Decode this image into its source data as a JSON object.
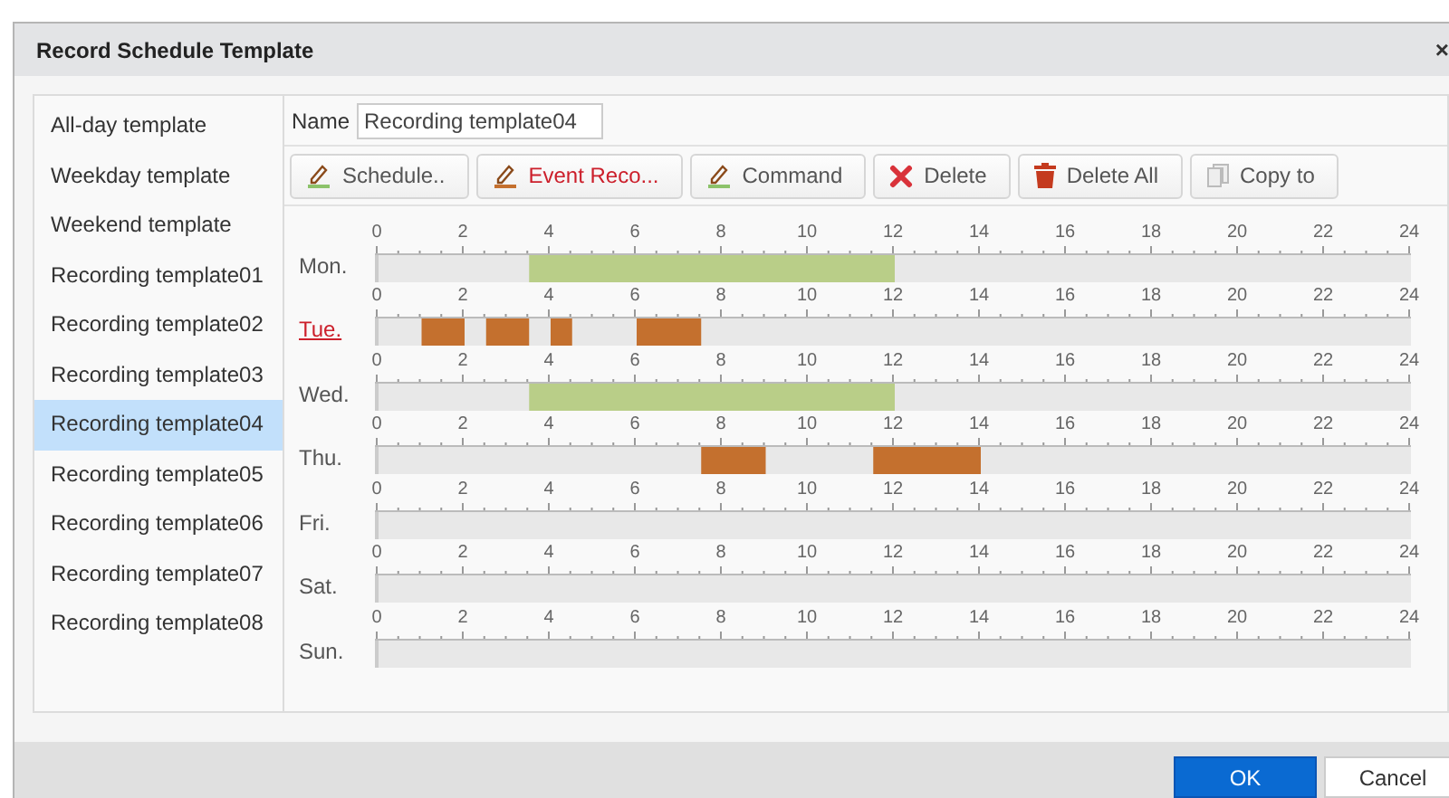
{
  "dialog": {
    "title": "Record Schedule Template",
    "close": "×"
  },
  "templates": [
    {
      "label": "All-day template",
      "selected": false
    },
    {
      "label": "Weekday template",
      "selected": false
    },
    {
      "label": "Weekend template",
      "selected": false
    },
    {
      "label": "Recording template01",
      "selected": false
    },
    {
      "label": "Recording template02",
      "selected": false
    },
    {
      "label": "Recording template03",
      "selected": false
    },
    {
      "label": "Recording template04",
      "selected": true
    },
    {
      "label": "Recording template05",
      "selected": false
    },
    {
      "label": "Recording template06",
      "selected": false
    },
    {
      "label": "Recording template07",
      "selected": false
    },
    {
      "label": "Recording template08",
      "selected": false
    }
  ],
  "name_field": {
    "label": "Name",
    "value": "Recording template04"
  },
  "toolbar": [
    {
      "kind": "schedule",
      "label": "Schedule..",
      "selected": false
    },
    {
      "kind": "event",
      "label": "Event Reco...",
      "selected": true
    },
    {
      "kind": "command",
      "label": "Command",
      "selected": false
    },
    {
      "kind": "delete",
      "label": "Delete",
      "selected": false
    },
    {
      "kind": "delete_all",
      "label": "Delete All",
      "selected": false
    },
    {
      "kind": "copy",
      "label": "Copy to",
      "selected": false
    }
  ],
  "days": [
    {
      "label": "Mon.",
      "selected": false,
      "ticks": [
        "0",
        "2",
        "4",
        "6",
        "8",
        "10",
        "12",
        "14",
        "16",
        "18",
        "20",
        "22",
        "24"
      ],
      "half_hours": [
        {
          "kind": "off"
        },
        {
          "kind": "off"
        },
        {
          "kind": "off"
        },
        {
          "kind": "off"
        },
        {
          "kind": "off"
        },
        {
          "kind": "off"
        },
        {
          "kind": "off"
        },
        {
          "kind": "schedule"
        },
        {
          "kind": "schedule"
        },
        {
          "kind": "schedule"
        },
        {
          "kind": "schedule"
        },
        {
          "kind": "schedule"
        },
        {
          "kind": "schedule"
        },
        {
          "kind": "schedule"
        },
        {
          "kind": "schedule"
        },
        {
          "kind": "schedule"
        },
        {
          "kind": "schedule"
        },
        {
          "kind": "schedule"
        },
        {
          "kind": "schedule"
        },
        {
          "kind": "schedule"
        },
        {
          "kind": "schedule"
        },
        {
          "kind": "schedule"
        },
        {
          "kind": "schedule"
        },
        {
          "kind": "schedule"
        },
        {
          "kind": "off"
        },
        {
          "kind": "off"
        },
        {
          "kind": "off"
        },
        {
          "kind": "off"
        },
        {
          "kind": "off"
        },
        {
          "kind": "off"
        },
        {
          "kind": "off"
        },
        {
          "kind": "off"
        },
        {
          "kind": "off"
        },
        {
          "kind": "off"
        },
        {
          "kind": "off"
        },
        {
          "kind": "off"
        },
        {
          "kind": "off"
        },
        {
          "kind": "off"
        },
        {
          "kind": "off"
        },
        {
          "kind": "off"
        },
        {
          "kind": "off"
        },
        {
          "kind": "off"
        },
        {
          "kind": "off"
        },
        {
          "kind": "off"
        },
        {
          "kind": "off"
        },
        {
          "kind": "off"
        },
        {
          "kind": "off"
        },
        {
          "kind": "off"
        }
      ]
    },
    {
      "label": "Tue.",
      "selected": true,
      "ticks": [
        "0",
        "2",
        "4",
        "6",
        "8",
        "10",
        "12",
        "14",
        "16",
        "18",
        "20",
        "22",
        "24"
      ],
      "half_hours": [
        {
          "kind": "off"
        },
        {
          "kind": "off"
        },
        {
          "kind": "event"
        },
        {
          "kind": "event"
        },
        {
          "kind": "off"
        },
        {
          "kind": "event"
        },
        {
          "kind": "event"
        },
        {
          "kind": "off"
        },
        {
          "kind": "event"
        },
        {
          "kind": "off"
        },
        {
          "kind": "off"
        },
        {
          "kind": "off"
        },
        {
          "kind": "event"
        },
        {
          "kind": "event"
        },
        {
          "kind": "event"
        },
        {
          "kind": "off"
        },
        {
          "kind": "off"
        },
        {
          "kind": "off"
        },
        {
          "kind": "off"
        },
        {
          "kind": "off"
        },
        {
          "kind": "off"
        },
        {
          "kind": "off"
        },
        {
          "kind": "off"
        },
        {
          "kind": "off"
        },
        {
          "kind": "off"
        },
        {
          "kind": "off"
        },
        {
          "kind": "off"
        },
        {
          "kind": "off"
        },
        {
          "kind": "off"
        },
        {
          "kind": "off"
        },
        {
          "kind": "off"
        },
        {
          "kind": "off"
        },
        {
          "kind": "off"
        },
        {
          "kind": "off"
        },
        {
          "kind": "off"
        },
        {
          "kind": "off"
        },
        {
          "kind": "off"
        },
        {
          "kind": "off"
        },
        {
          "kind": "off"
        },
        {
          "kind": "off"
        },
        {
          "kind": "off"
        },
        {
          "kind": "off"
        },
        {
          "kind": "off"
        },
        {
          "kind": "off"
        },
        {
          "kind": "off"
        },
        {
          "kind": "off"
        },
        {
          "kind": "off"
        },
        {
          "kind": "off"
        }
      ]
    },
    {
      "label": "Wed.",
      "selected": false,
      "ticks": [
        "0",
        "2",
        "4",
        "6",
        "8",
        "10",
        "12",
        "14",
        "16",
        "18",
        "20",
        "22",
        "24"
      ],
      "half_hours": [
        {
          "kind": "off"
        },
        {
          "kind": "off"
        },
        {
          "kind": "off"
        },
        {
          "kind": "off"
        },
        {
          "kind": "off"
        },
        {
          "kind": "off"
        },
        {
          "kind": "off"
        },
        {
          "kind": "schedule"
        },
        {
          "kind": "schedule"
        },
        {
          "kind": "schedule"
        },
        {
          "kind": "schedule"
        },
        {
          "kind": "schedule"
        },
        {
          "kind": "schedule"
        },
        {
          "kind": "schedule"
        },
        {
          "kind": "schedule"
        },
        {
          "kind": "schedule"
        },
        {
          "kind": "schedule"
        },
        {
          "kind": "schedule"
        },
        {
          "kind": "schedule"
        },
        {
          "kind": "schedule"
        },
        {
          "kind": "schedule"
        },
        {
          "kind": "schedule"
        },
        {
          "kind": "schedule"
        },
        {
          "kind": "schedule"
        },
        {
          "kind": "off"
        },
        {
          "kind": "off"
        },
        {
          "kind": "off"
        },
        {
          "kind": "off"
        },
        {
          "kind": "off"
        },
        {
          "kind": "off"
        },
        {
          "kind": "off"
        },
        {
          "kind": "off"
        },
        {
          "kind": "off"
        },
        {
          "kind": "off"
        },
        {
          "kind": "off"
        },
        {
          "kind": "off"
        },
        {
          "kind": "off"
        },
        {
          "kind": "off"
        },
        {
          "kind": "off"
        },
        {
          "kind": "off"
        },
        {
          "kind": "off"
        },
        {
          "kind": "off"
        },
        {
          "kind": "off"
        },
        {
          "kind": "off"
        },
        {
          "kind": "off"
        },
        {
          "kind": "off"
        },
        {
          "kind": "off"
        },
        {
          "kind": "off"
        }
      ]
    },
    {
      "label": "Thu.",
      "selected": false,
      "ticks": [
        "0",
        "2",
        "4",
        "6",
        "8",
        "10",
        "12",
        "14",
        "16",
        "18",
        "20",
        "22",
        "24"
      ],
      "half_hours": [
        {
          "kind": "off"
        },
        {
          "kind": "off"
        },
        {
          "kind": "off"
        },
        {
          "kind": "off"
        },
        {
          "kind": "off"
        },
        {
          "kind": "off"
        },
        {
          "kind": "off"
        },
        {
          "kind": "off"
        },
        {
          "kind": "off"
        },
        {
          "kind": "off"
        },
        {
          "kind": "off"
        },
        {
          "kind": "off"
        },
        {
          "kind": "off"
        },
        {
          "kind": "off"
        },
        {
          "kind": "off"
        },
        {
          "kind": "event"
        },
        {
          "kind": "event"
        },
        {
          "kind": "event"
        },
        {
          "kind": "off"
        },
        {
          "kind": "off"
        },
        {
          "kind": "off"
        },
        {
          "kind": "off"
        },
        {
          "kind": "off"
        },
        {
          "kind": "event"
        },
        {
          "kind": "event"
        },
        {
          "kind": "event"
        },
        {
          "kind": "event"
        },
        {
          "kind": "event"
        },
        {
          "kind": "off"
        },
        {
          "kind": "off"
        },
        {
          "kind": "off"
        },
        {
          "kind": "off"
        },
        {
          "kind": "off"
        },
        {
          "kind": "off"
        },
        {
          "kind": "off"
        },
        {
          "kind": "off"
        },
        {
          "kind": "off"
        },
        {
          "kind": "off"
        },
        {
          "kind": "off"
        },
        {
          "kind": "off"
        },
        {
          "kind": "off"
        },
        {
          "kind": "off"
        },
        {
          "kind": "off"
        },
        {
          "kind": "off"
        },
        {
          "kind": "off"
        },
        {
          "kind": "off"
        },
        {
          "kind": "off"
        },
        {
          "kind": "off"
        }
      ]
    },
    {
      "label": "Fri.",
      "selected": false,
      "ticks": [
        "0",
        "2",
        "4",
        "6",
        "8",
        "10",
        "12",
        "14",
        "16",
        "18",
        "20",
        "22",
        "24"
      ]
    },
    {
      "label": "Sat.",
      "selected": false,
      "ticks": [
        "0",
        "2",
        "4",
        "6",
        "8",
        "10",
        "12",
        "14",
        "16",
        "18",
        "20",
        "22",
        "24"
      ]
    },
    {
      "label": "Sun.",
      "selected": false,
      "ticks": [
        "0",
        "2",
        "4",
        "6",
        "8",
        "10",
        "12",
        "14",
        "16",
        "18",
        "20",
        "22",
        "24"
      ]
    }
  ],
  "buttons": [
    {
      "kind": "primary",
      "label": "OK"
    },
    {
      "kind": "secondary",
      "label": "Cancel"
    }
  ]
}
